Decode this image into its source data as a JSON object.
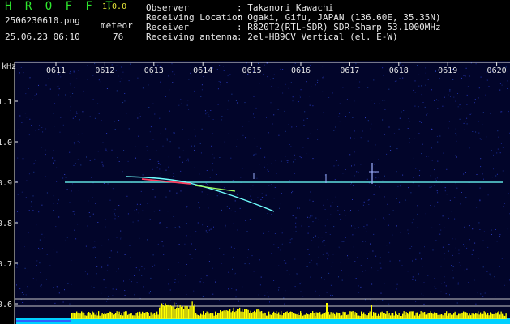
{
  "app": {
    "title": "H R O F F T",
    "version": "1.0.0"
  },
  "file": {
    "name": "2506230610.png",
    "datetime": "25.06.23 06:10"
  },
  "meteor": {
    "label": "meteor",
    "count": "76"
  },
  "info": [
    {
      "key": "Observer",
      "value": ": Takanori Kawachi"
    },
    {
      "key": "Receiving Location",
      "value": ": Ogaki, Gifu, JAPAN (136.60E, 35.35N)"
    },
    {
      "key": "Receiver",
      "value": ": R820T2(RTL-SDR) SDR-Sharp 53.1000MHz"
    },
    {
      "key": "Receiving antenna",
      "value": ": 2el-HB9CV Vertical (el. E-W)"
    }
  ],
  "axis": {
    "unit": "kHz",
    "x_ticks": [
      "0611",
      "0612",
      "0613",
      "0614",
      "0615",
      "0616",
      "0617",
      "0618",
      "0619",
      "0620"
    ],
    "y_ticks": [
      "1.1",
      "1.0",
      "0.9",
      "0.8",
      "0.7",
      "0.6"
    ],
    "y_range": [
      0.56,
      1.2
    ]
  },
  "colors": {
    "background": "#000000",
    "text": "#e8e8e8",
    "title": "#2ee62e",
    "version": "#e8e83a",
    "axis": "#e8e8e8",
    "carrier": "#60e0e0",
    "echo": "#70ffff",
    "activity_bar": "#ffff00",
    "activity_base": "#00d0ff"
  }
}
